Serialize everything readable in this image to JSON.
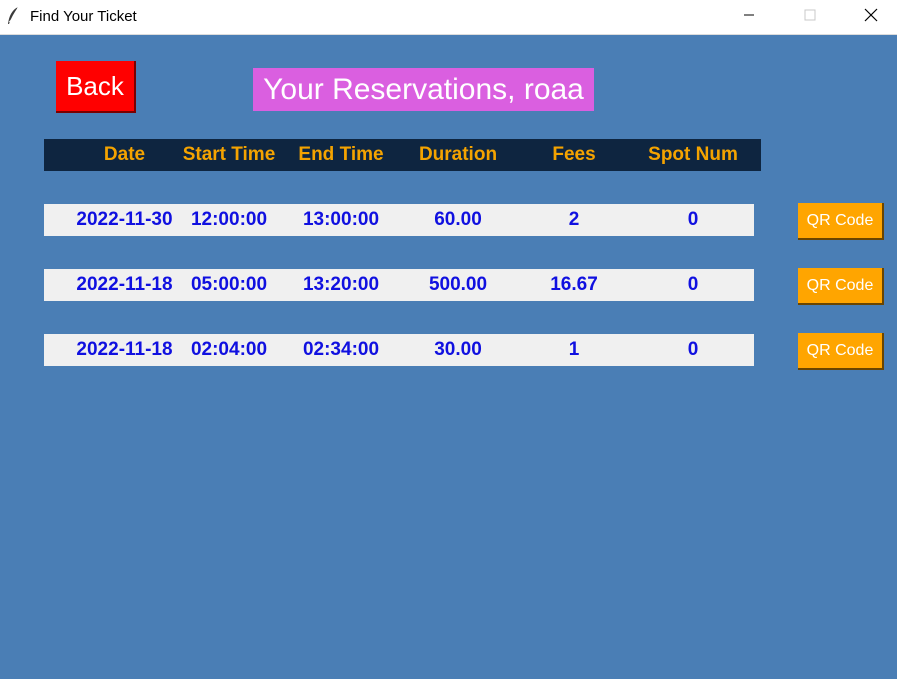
{
  "window": {
    "title": "Find Your Ticket",
    "icon": "feather-icon",
    "controls": [
      "minimize-icon",
      "maximize-icon",
      "close-icon"
    ]
  },
  "colors": {
    "background": "#4a7eb5",
    "back_button": "#ff0000",
    "title_banner": "#da5fe0",
    "header_bg": "#0e2540",
    "header_text": "#f4a300",
    "row_bg": "#f0f0f0",
    "row_text": "#1010e0",
    "qr_button": "#ffa500"
  },
  "back_label": "Back",
  "page_title": "Your Reservations, roaa",
  "table": {
    "headers": {
      "date": "Date",
      "start": "Start Time",
      "end": "End Time",
      "duration": "Duration",
      "fees": "Fees",
      "spot": "Spot Num"
    },
    "rows": [
      {
        "date": "2022-11-30",
        "start": "12:00:00",
        "end": "13:00:00",
        "duration": "60.00",
        "fees": "2",
        "spot": "0",
        "qr_label": "QR Code"
      },
      {
        "date": "2022-11-18",
        "start": "05:00:00",
        "end": "13:20:00",
        "duration": "500.00",
        "fees": "16.67",
        "spot": "0",
        "qr_label": "QR Code"
      },
      {
        "date": "2022-11-18",
        "start": "02:04:00",
        "end": "02:34:00",
        "duration": "30.00",
        "fees": "1",
        "spot": "0",
        "qr_label": "QR Code"
      }
    ]
  }
}
